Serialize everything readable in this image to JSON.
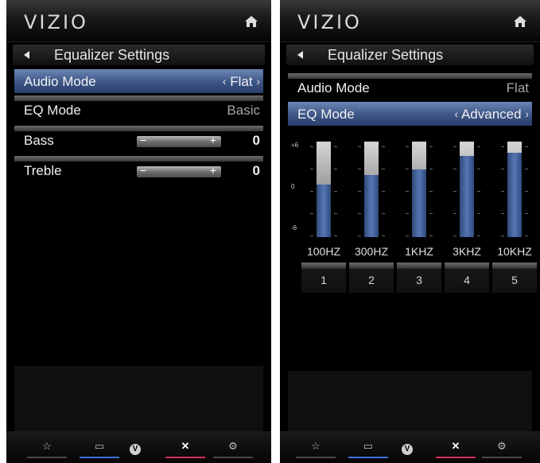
{
  "left": {
    "logo": "VIZIO",
    "title": "Equalizer Settings",
    "rows": [
      {
        "label": "Audio Mode",
        "value": "Flat"
      },
      {
        "label": "EQ Mode",
        "value": "Basic"
      },
      {
        "label": "Bass",
        "value": "0"
      },
      {
        "label": "Treble",
        "value": "0"
      }
    ],
    "slider_minus": "−",
    "slider_plus": "+"
  },
  "right": {
    "logo": "VIZIO",
    "title": "Equalizer Settings",
    "rows": [
      {
        "label": "Audio Mode",
        "value": "Flat"
      },
      {
        "label": "EQ Mode",
        "value": "Advanced"
      }
    ],
    "eq_scale": {
      "top": "+6",
      "mid": "0",
      "bottom": "-6"
    },
    "bands": [
      {
        "freq": "100HZ",
        "num": "1",
        "level": 0.55
      },
      {
        "freq": "300HZ",
        "num": "2",
        "level": 0.65
      },
      {
        "freq": "1KHZ",
        "num": "3",
        "level": 0.71
      },
      {
        "freq": "3KHZ",
        "num": "4",
        "level": 0.85
      },
      {
        "freq": "10KHZ",
        "num": "5",
        "level": 0.88
      }
    ]
  },
  "bottom_icons": [
    "star-icon",
    "screen-icon",
    "vizio-v-icon",
    "close-icon",
    "gear-icon"
  ],
  "colors": {
    "highlight": "#3c5585",
    "eq_fill": "#5677b4",
    "accent_blue": "#3d6fd0",
    "accent_red": "#d0305a"
  }
}
